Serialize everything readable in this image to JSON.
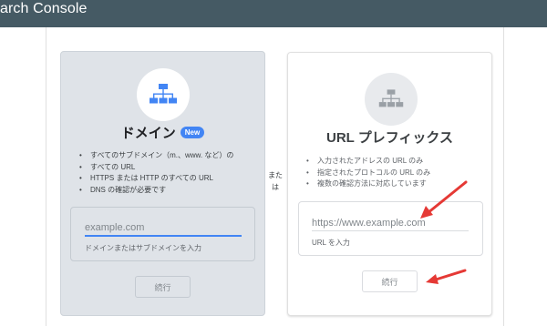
{
  "header": {
    "title": "arch Console"
  },
  "domain_card": {
    "title": "ドメイン",
    "badge": "New",
    "bullets": [
      "すべてのサブドメイン（m.、www. など）の",
      "すべての URL",
      "HTTPS または HTTP のすべての URL",
      "DNS の確認が必要です"
    ],
    "input_placeholder": "example.com",
    "input_hint": "ドメインまたはサブドメインを入力",
    "continue_label": "続行"
  },
  "or_label": {
    "line1": "また",
    "line2": "は"
  },
  "prefix_card": {
    "title": "URL プレフィックス",
    "bullets": [
      "入力されたアドレスの URL のみ",
      "指定されたプロトコルの URL のみ",
      "複数の確認方法に対応しています"
    ],
    "input_placeholder": "https://www.example.com",
    "input_hint": "URL を入力",
    "continue_label": "続行"
  },
  "colors": {
    "topbar": "#455a64",
    "accent": "#4285f4",
    "annotation_arrow": "#e53935",
    "domain_card_bg": "#dfe3e8"
  },
  "icons": {
    "domain": "sitemap-icon",
    "prefix": "sitemap-icon",
    "annotations": "red-arrow-icon"
  }
}
